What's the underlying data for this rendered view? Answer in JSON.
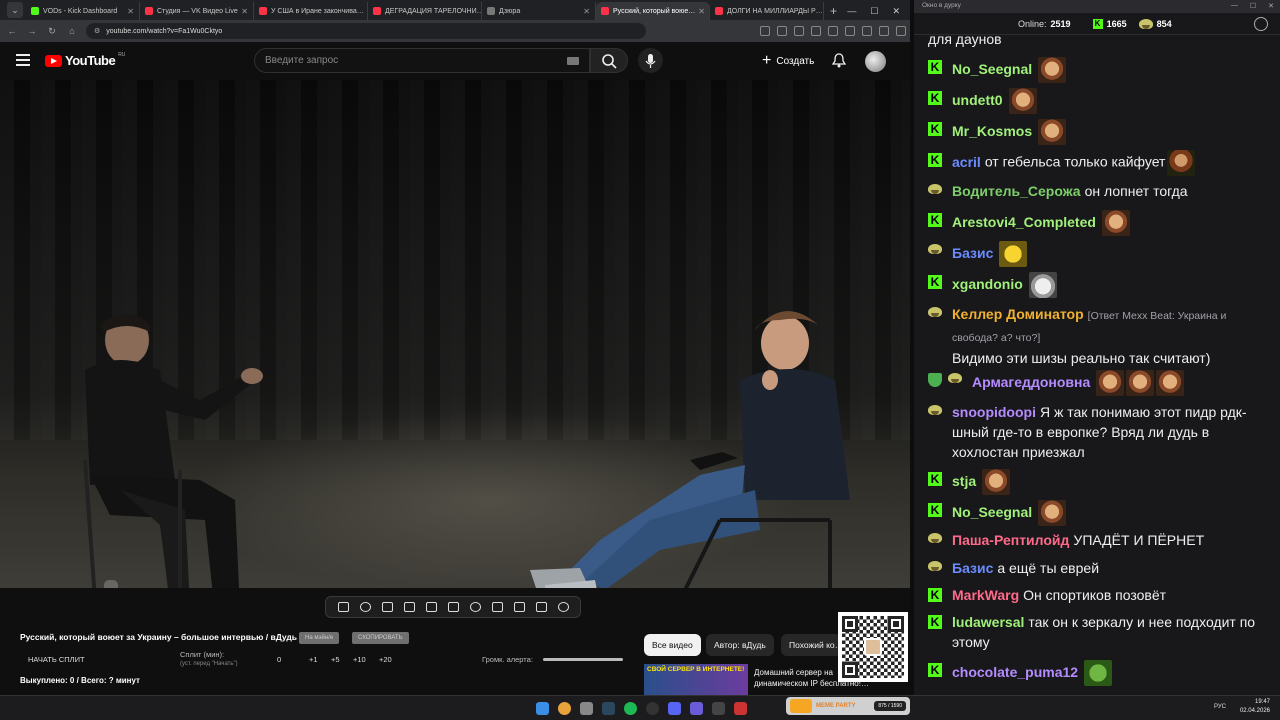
{
  "browser": {
    "tabs": [
      {
        "label": "VODs - Kick Dashboard",
        "color": "#53fc18",
        "active": false
      },
      {
        "label": "Студия — VK Видео Live",
        "color": "#ff3347",
        "active": false
      },
      {
        "label": "У США в Иране закончива…",
        "color": "#ff3347",
        "active": false
      },
      {
        "label": "ДЕГРАДАЦИЯ ТАРЕЛОЧНИ…",
        "color": "#ff3347",
        "active": false
      },
      {
        "label": "Дзюра",
        "color": "#777777",
        "active": false
      },
      {
        "label": "Русский, который воюе…",
        "color": "#ff3347",
        "active": true
      },
      {
        "label": "ДОЛГИ НА МИЛЛИАРДЫ Р…",
        "color": "#ff3347",
        "active": false
      }
    ],
    "url": "youtube.com/watch?v=Fa1Wu0Cktyo"
  },
  "youtube": {
    "logo_text": "YouTube",
    "region": "RU",
    "search_placeholder": "Введите запрос",
    "create_label": "Создать"
  },
  "player": {
    "video_title": "Русский, который воюет за Украину – большое интервью / вДудь",
    "btn_on_main": "На мэйн/е",
    "btn_copy": "СКОПИРОВАТЬ",
    "start_split": "НАЧАТЬ СПЛИТ",
    "split_label": "Сплит (мин):",
    "split_hint": "(уст. перед \"Начать\")",
    "split_values": [
      "0",
      "+1",
      "+5",
      "+10",
      "+20"
    ],
    "alert_label": "Громк. алерта:",
    "paid_label": "Выкуплено: 0 / Всего: ? минут"
  },
  "recommendations": {
    "chips": [
      "Все видео",
      "Автор: вДудь",
      "Похожий ко…"
    ],
    "rec_thumb_text": "СВОЙ СЕРВЕР В ИНТЕРНЕТЕ!",
    "rec_title": "Домашний сервер на динамическом IP бесплатно!…"
  },
  "chat": {
    "window_title": "Окно в дурку",
    "online_label": "Online:",
    "online_count": "2519",
    "kick_count": "1665",
    "other_count": "854",
    "messages": [
      {
        "badge": "none",
        "user": "",
        "color": "#efeff1",
        "text": "для даунов",
        "emotes": []
      },
      {
        "badge": "kick",
        "user": "No_Seegnal",
        "color": "#a0f07a",
        "text": "",
        "emotes": [
          "face"
        ]
      },
      {
        "badge": "kick",
        "user": "undett0",
        "color": "#a0f07a",
        "text": "",
        "emotes": [
          "face"
        ]
      },
      {
        "badge": "kick",
        "user": "Mr_Kosmos",
        "color": "#a0f07a",
        "text": "",
        "emotes": [
          "face"
        ]
      },
      {
        "badge": "kick",
        "user": "acril",
        "color": "#6a8cff",
        "text": "от гебельса только кайфует",
        "emotes": [
          "man"
        ]
      },
      {
        "badge": "frog",
        "user": "Водитель_Серожа",
        "color": "#7dcf6a",
        "text": "он лопнет тогда",
        "emotes": []
      },
      {
        "badge": "kick",
        "user": "Arestovi4_Completed",
        "color": "#a0f07a",
        "text": "",
        "emotes": [
          "face"
        ]
      },
      {
        "badge": "frog",
        "user": "Базис",
        "color": "#6a8cff",
        "text": "",
        "emotes": [
          "laugh"
        ]
      },
      {
        "badge": "kick",
        "user": "xgandonio",
        "color": "#a0f07a",
        "text": "",
        "emotes": [
          "cat"
        ]
      },
      {
        "badge": "frog",
        "user": "Келлер Доминатор",
        "color": "#f0b030",
        "text": "Видимо эти шизы реально так считают)",
        "reply": "[Ответ Mexx Beat: Украина и свобода? а? что?]",
        "emotes": []
      },
      {
        "badge": "shield-frog",
        "user": "Армагеддоновна",
        "color": "#b48cff",
        "text": "",
        "emotes": [
          "face",
          "face",
          "face"
        ]
      },
      {
        "badge": "frog",
        "user": "snoopidoopi",
        "color": "#b48cff",
        "text": "Я ж так понимаю этот пидр рдк-шный где-то в европке? Вряд ли дудь в хохлостан приезжал",
        "emotes": []
      },
      {
        "badge": "kick",
        "user": "stja",
        "color": "#a0f07a",
        "text": "",
        "emotes": [
          "face"
        ]
      },
      {
        "badge": "kick",
        "user": "No_Seegnal",
        "color": "#a0f07a",
        "text": "",
        "emotes": [
          "face"
        ]
      },
      {
        "badge": "frog",
        "user": "Паша-Рептилойд",
        "color": "#ff6a8a",
        "text": "УПАДЁТ И ПЁРНЕТ",
        "emotes": []
      },
      {
        "badge": "frog",
        "user": "Базис",
        "color": "#6a8cff",
        "text": "а ещё ты еврей",
        "emotes": []
      },
      {
        "badge": "kick",
        "user": "MarkWarg",
        "color": "#ff6a8a",
        "text": "Он спортиков позовёт",
        "emotes": []
      },
      {
        "badge": "kick",
        "user": "ludawersal",
        "color": "#a0f07a",
        "text": "так он к зеркалу и нее подходит по этому",
        "emotes": []
      },
      {
        "badge": "kick",
        "user": "chocolate_puma12",
        "color": "#b48cff",
        "text": "",
        "emotes": [
          "pepe"
        ]
      }
    ]
  },
  "taskbar": {
    "widget_title": "MEME PARTY",
    "widget_count": "875 / 1590",
    "lang": "РУС",
    "time": "19:47",
    "date": "02.04.2026"
  }
}
